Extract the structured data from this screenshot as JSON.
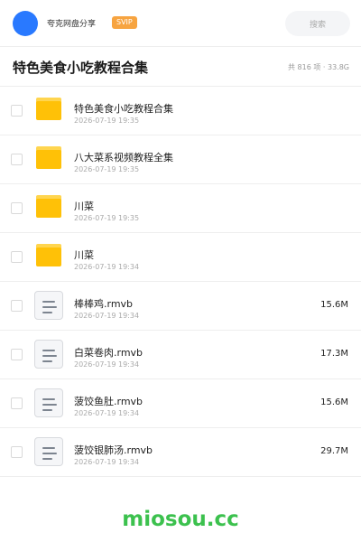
{
  "header": {
    "share_name": "夸克网盘分享",
    "badge": "SVIP",
    "search_placeholder": "搜索"
  },
  "folder": {
    "title": "特色美食小吃教程合集",
    "summary": "共 816 项 · 33.8G"
  },
  "items": [
    {
      "type": "folder",
      "icon": "folder-icon",
      "name": "特色美食小吃教程合集",
      "date": "2026-07-19 19:35",
      "size": ""
    },
    {
      "type": "folder",
      "icon": "folder-icon",
      "name": "八大菜系视频教程全集",
      "date": "2026-07-19 19:35",
      "size": ""
    },
    {
      "type": "folder",
      "icon": "folder-icon",
      "name": "川菜",
      "date": "2026-07-19 19:35",
      "size": ""
    },
    {
      "type": "folder",
      "icon": "folder-icon",
      "name": "川菜",
      "date": "2026-07-19 19:34",
      "size": ""
    },
    {
      "type": "file",
      "icon": "file-icon",
      "name": "棒棒鸡.rmvb",
      "date": "2026-07-19 19:34",
      "size": "15.6M"
    },
    {
      "type": "file",
      "icon": "file-icon",
      "name": "白菜卷肉.rmvb",
      "date": "2026-07-19 19:34",
      "size": "17.3M"
    },
    {
      "type": "file",
      "icon": "file-icon",
      "name": "菠饺鱼肚.rmvb",
      "date": "2026-07-19 19:34",
      "size": "15.6M"
    },
    {
      "type": "file",
      "icon": "file-icon",
      "name": "菠饺银肺汤.rmvb",
      "date": "2026-07-19 19:34",
      "size": "29.7M"
    }
  ],
  "watermark": "miosou.cc",
  "colors": {
    "avatar": "#2979ff",
    "svip_badge": "#f7a440",
    "folder": "#ffc107",
    "watermark": "#3cc14e"
  }
}
